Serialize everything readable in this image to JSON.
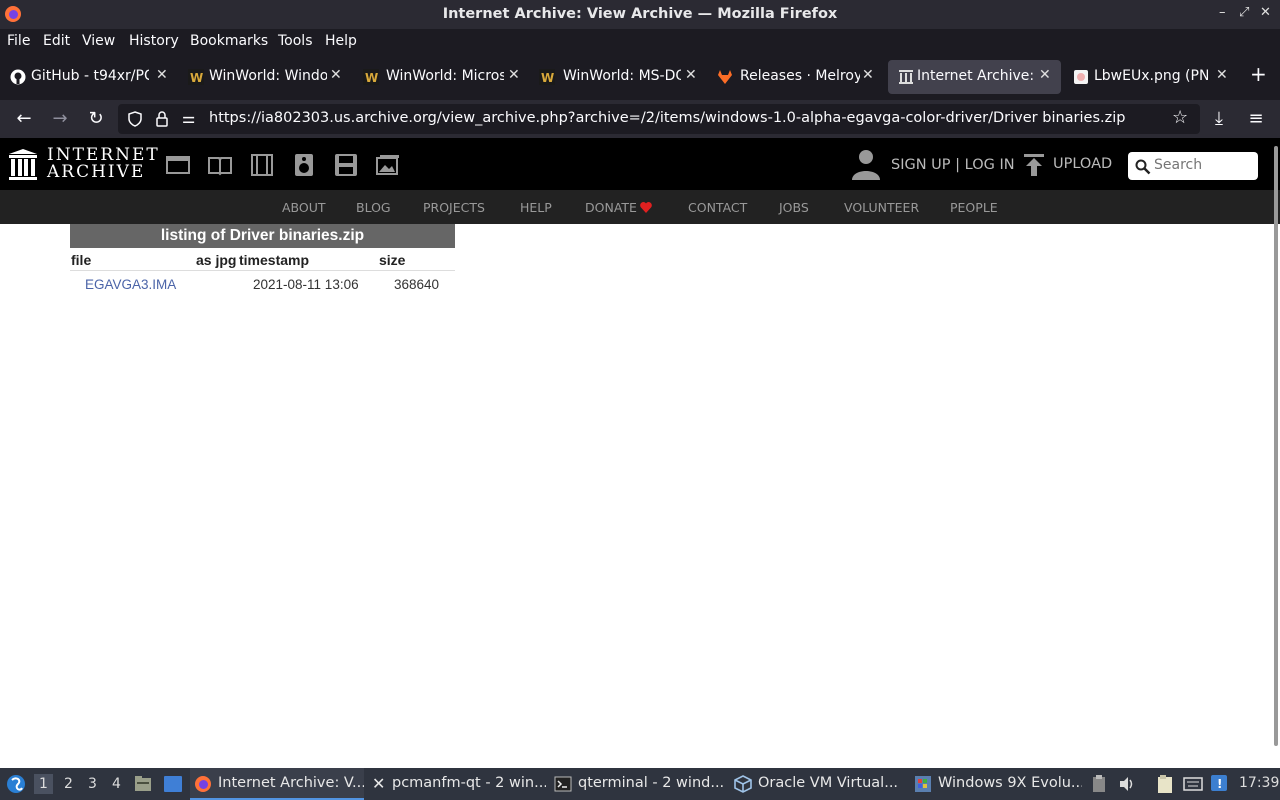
{
  "window": {
    "title": "Internet Archive: View Archive — Mozilla Firefox",
    "controls": [
      "–",
      "⤢",
      "✕"
    ]
  },
  "menu": [
    "File",
    "Edit",
    "View",
    "History",
    "Bookmarks",
    "Tools",
    "Help"
  ],
  "tabs": [
    {
      "title": "GitHub - t94xr/PC",
      "icon": "github-icon"
    },
    {
      "title": "WinWorld: Window",
      "icon": "winworld-icon"
    },
    {
      "title": "WinWorld: Micros",
      "icon": "winworld-icon"
    },
    {
      "title": "WinWorld: MS-DO",
      "icon": "winworld-icon"
    },
    {
      "title": "Releases · Melroy",
      "icon": "gitlab-icon"
    },
    {
      "title": "Internet Archive: V",
      "icon": "archive-icon",
      "active": true
    },
    {
      "title": "LbwEUx.png (PNG",
      "icon": "image-icon"
    }
  ],
  "navbar": {
    "url": "https://ia802303.us.archive.org/view_archive.php?archive=/2/items/windows-1.0-alpha-egavga-color-driver/Driver binaries.zip"
  },
  "ia": {
    "logo_line1": "INTERNET",
    "logo_line2": "ARCHIVE",
    "signup": "SIGN UP | LOG IN",
    "upload": "UPLOAD",
    "search_placeholder": "Search",
    "nav": [
      "ABOUT",
      "BLOG",
      "PROJECTS",
      "HELP",
      "DONATE",
      "CONTACT",
      "JOBS",
      "VOLUNTEER",
      "PEOPLE"
    ],
    "donate_heart_color": "#e02020"
  },
  "listing": {
    "caption": "listing of Driver binaries.zip",
    "headers": [
      "file",
      "as jpg",
      "timestamp",
      "size"
    ],
    "rows": [
      {
        "file": "EGAVGA3.IMA",
        "as_jpg": "",
        "timestamp": "2021-08-11 13:06",
        "size": "368640"
      }
    ]
  },
  "taskbar": {
    "workspaces": [
      "1",
      "2",
      "3",
      "4"
    ],
    "tasks": [
      {
        "label": "Internet Archive: V...",
        "icon": "firefox-icon",
        "active": true
      },
      {
        "label": "pcmanfm-qt - 2 win...",
        "icon": "close-x-icon"
      },
      {
        "label": "qterminal - 2 wind...",
        "icon": "terminal-icon"
      },
      {
        "label": "Oracle VM Virtual...",
        "icon": "virtualbox-icon"
      },
      {
        "label": "Windows 9X Evolu...",
        "icon": "windows-icon"
      }
    ],
    "clock": "17:39"
  }
}
